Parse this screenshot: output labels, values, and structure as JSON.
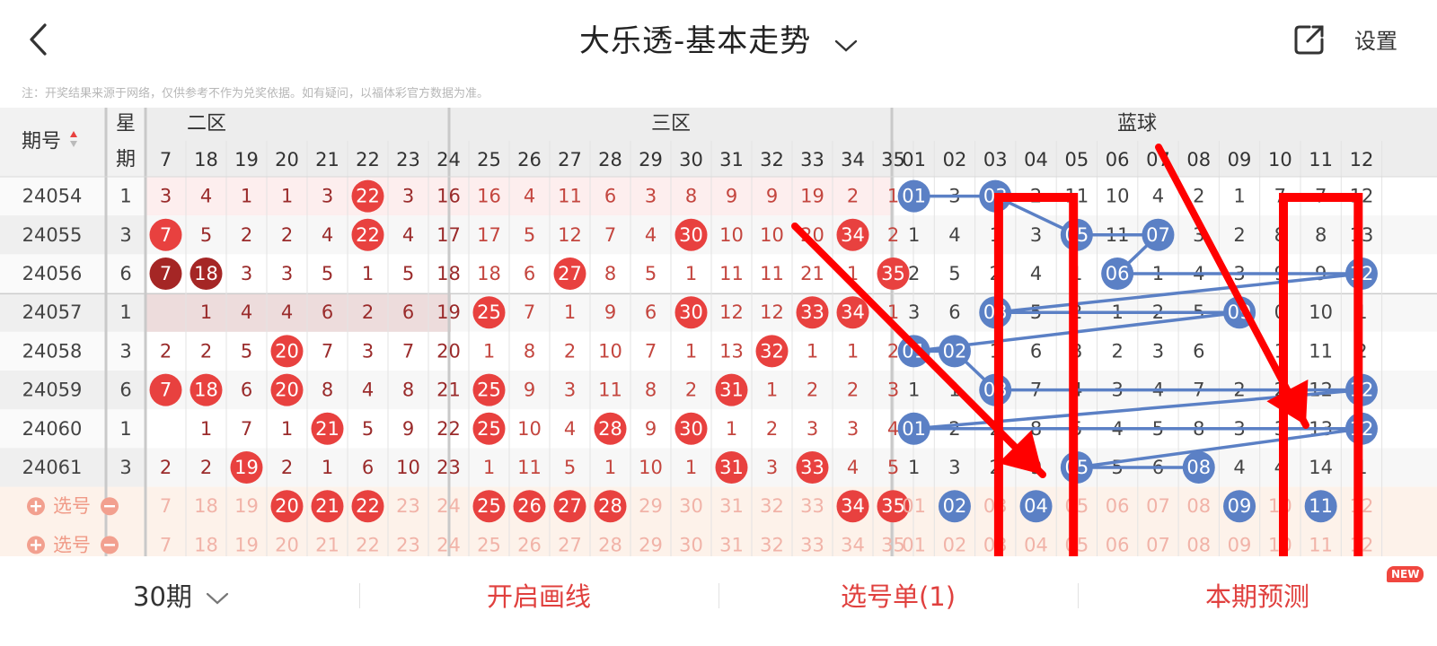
{
  "header": {
    "title": "大乐透-基本走势",
    "settings_label": "设置",
    "back_icon": "back-chevron-icon",
    "share_icon": "share-external-icon"
  },
  "note": "注：开奖结果来源于网络，仅供参考不作为兑奖依据。如有疑问，以福体彩官方数据为准。",
  "table": {
    "period_header": "期号",
    "weekday_header": [
      "星",
      "期"
    ],
    "sections": [
      "二区",
      "三区",
      "蓝球"
    ],
    "red_columns": [
      "7",
      "18",
      "19",
      "20",
      "21",
      "22",
      "23",
      "24",
      "25",
      "26",
      "27",
      "28",
      "29",
      "30",
      "31",
      "32",
      "33",
      "34",
      "35"
    ],
    "blue_columns": [
      "01",
      "02",
      "03",
      "04",
      "05",
      "06",
      "07",
      "08",
      "09",
      "10",
      "11",
      "12"
    ],
    "rows": [
      {
        "period": "24054",
        "weekday": "1",
        "red": [
          "3",
          "4",
          "1",
          "1",
          "3",
          "22",
          "3",
          "16",
          "16",
          "4",
          "11",
          "6",
          "3",
          "8",
          "9",
          "9",
          "19",
          "2",
          "1"
        ],
        "red_hits": [
          22
        ],
        "blue": [
          "01",
          "3",
          "03",
          "2",
          "11",
          "10",
          "4",
          "2",
          "1",
          "7",
          "7",
          "12"
        ],
        "blue_hits": [
          1,
          3
        ]
      },
      {
        "period": "24055",
        "weekday": "3",
        "red": [
          "7",
          "5",
          "2",
          "2",
          "4",
          "22",
          "4",
          "17",
          "17",
          "5",
          "12",
          "7",
          "4",
          "30",
          "10",
          "10",
          "20",
          "34",
          "2"
        ],
        "red_hits": [
          7,
          22,
          30,
          34
        ],
        "blue": [
          "1",
          "4",
          "1",
          "3",
          "05",
          "11",
          "07",
          "3",
          "2",
          "8",
          "8",
          "13"
        ],
        "blue_hits": [
          5,
          7
        ]
      },
      {
        "period": "24056",
        "weekday": "6",
        "red": [
          "7",
          "18",
          "3",
          "3",
          "5",
          "1",
          "5",
          "18",
          "18",
          "6",
          "27",
          "8",
          "5",
          "1",
          "11",
          "11",
          "21",
          "1",
          "35"
        ],
        "red_hits": [
          7,
          18,
          27,
          35
        ],
        "red_hit_dark": [
          7,
          18
        ],
        "blue": [
          "2",
          "5",
          "2",
          "4",
          "1",
          "06",
          "1",
          "4",
          "3",
          "9",
          "9",
          "12"
        ],
        "blue_hits": [
          6,
          12
        ]
      },
      {
        "period": "24057",
        "weekday": "1",
        "red": [
          "",
          "1",
          "4",
          "4",
          "6",
          "2",
          "6",
          "19",
          "25",
          "7",
          "1",
          "9",
          "6",
          "30",
          "12",
          "12",
          "33",
          "34",
          "1"
        ],
        "red_hits": [
          25,
          30,
          33,
          34
        ],
        "blue": [
          "3",
          "6",
          "03",
          "5",
          "2",
          "1",
          "2",
          "5",
          "09",
          "0",
          "10",
          "1"
        ],
        "blue_hits": [
          3,
          9
        ]
      },
      {
        "period": "24058",
        "weekday": "3",
        "red": [
          "2",
          "2",
          "5",
          "20",
          "7",
          "3",
          "7",
          "20",
          "1",
          "8",
          "2",
          "10",
          "7",
          "1",
          "13",
          "32",
          "1",
          "1",
          "2"
        ],
        "red_hits": [
          20,
          32
        ],
        "blue": [
          "01",
          "02",
          "1",
          "6",
          "3",
          "2",
          "3",
          "6",
          "",
          "1",
          "11",
          "2"
        ],
        "blue_hits": [
          1,
          2
        ]
      },
      {
        "period": "24059",
        "weekday": "6",
        "red": [
          "7",
          "18",
          "6",
          "20",
          "8",
          "4",
          "8",
          "21",
          "25",
          "9",
          "3",
          "11",
          "8",
          "2",
          "31",
          "1",
          "2",
          "2",
          "3"
        ],
        "red_hits": [
          7,
          18,
          20,
          25,
          31
        ],
        "blue": [
          "1",
          "1",
          "03",
          "7",
          "4",
          "3",
          "4",
          "7",
          "2",
          "2",
          "12",
          "12"
        ],
        "blue_hits": [
          3,
          12
        ]
      },
      {
        "period": "24060",
        "weekday": "1",
        "red": [
          "",
          "1",
          "7",
          "1",
          "21",
          "5",
          "9",
          "22",
          "25",
          "10",
          "4",
          "28",
          "9",
          "30",
          "1",
          "2",
          "3",
          "3",
          "4"
        ],
        "red_hits": [
          21,
          25,
          28,
          30
        ],
        "blue": [
          "01",
          "2",
          "2",
          "8",
          "5",
          "4",
          "5",
          "8",
          "3",
          "3",
          "13",
          "12"
        ],
        "blue_hits": [
          1,
          12
        ]
      },
      {
        "period": "24061",
        "weekday": "3",
        "red": [
          "2",
          "2",
          "19",
          "2",
          "1",
          "6",
          "10",
          "23",
          "1",
          "11",
          "5",
          "1",
          "10",
          "1",
          "31",
          "3",
          "33",
          "4",
          "5"
        ],
        "red_hits": [
          19,
          31,
          33
        ],
        "blue": [
          "1",
          "3",
          "2",
          "9",
          "05",
          "5",
          "6",
          "08",
          "4",
          "4",
          "14",
          "1"
        ],
        "blue_hits": [
          5,
          8
        ]
      }
    ],
    "pick_rows": [
      {
        "label": "选号",
        "red_selected": [
          20,
          21,
          22,
          25,
          26,
          27,
          28,
          34,
          35
        ],
        "blue_selected": [
          2,
          4,
          9,
          11
        ]
      },
      {
        "label": "选号",
        "red_selected": [],
        "blue_selected": []
      }
    ]
  },
  "overlay": {
    "highlight_columns": [
      "04",
      "11"
    ],
    "color": "#ff0000"
  },
  "bottom_bar": {
    "periods_label": "30期",
    "draw_lines_label": "开启画线",
    "pick_list_label": "选号单(1)",
    "predict_label": "本期预测",
    "new_badge": "NEW"
  },
  "colors": {
    "red_ball": "#e8413f",
    "dark_red_ball": "#a52625",
    "blue_ball": "#5b80c5",
    "red_text": "#c0392b",
    "accent": "#e0403e"
  }
}
